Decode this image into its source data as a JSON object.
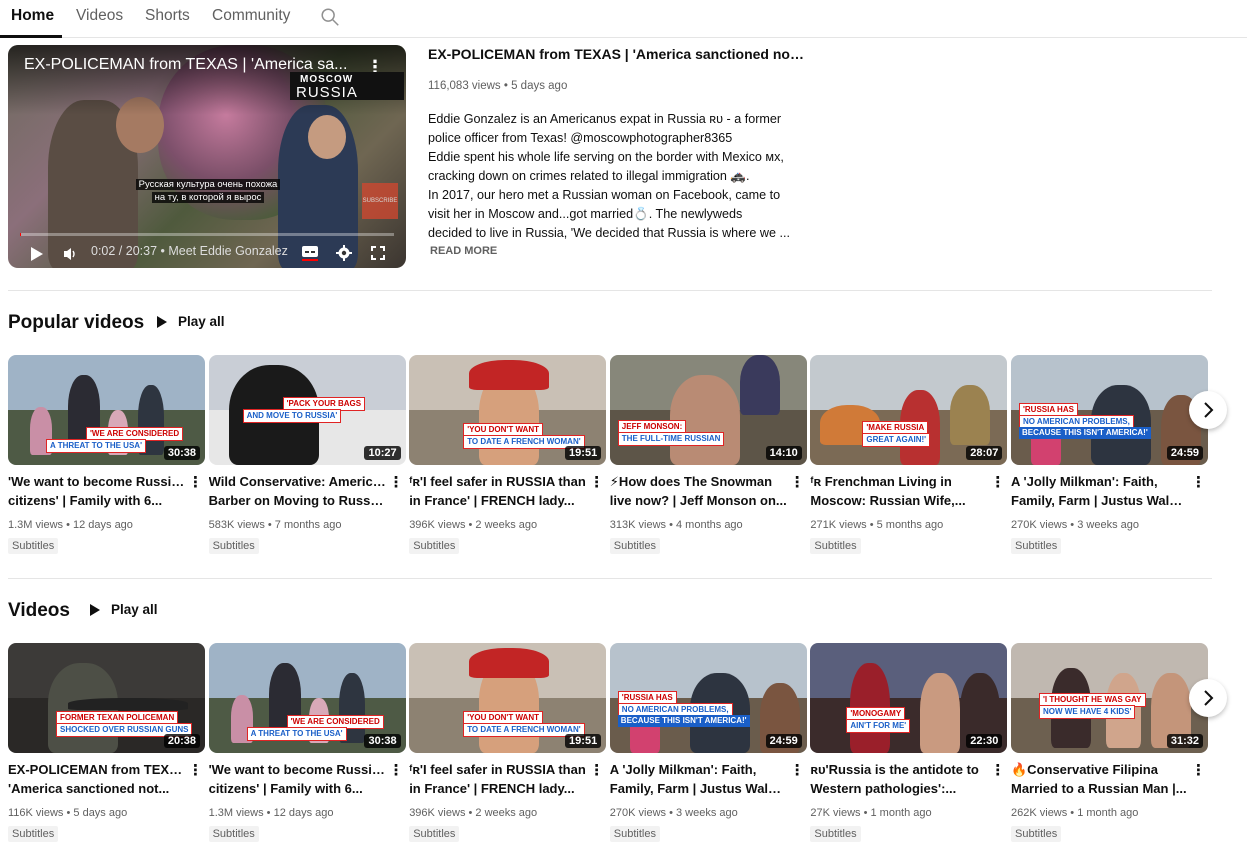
{
  "tabs": [
    {
      "label": "Home",
      "active": true
    },
    {
      "label": "Videos"
    },
    {
      "label": "Shorts"
    },
    {
      "label": "Community"
    }
  ],
  "featured": {
    "player_title": "EX-POLICEMAN from TEXAS | 'America sa...",
    "logo_top": "MOSCOW",
    "logo_bottom": "RUSSIA",
    "subtitle_line1": "Русская культура очень похожа",
    "subtitle_line2": "на ту, в которой я вырос",
    "subscribe_watermark": "SUBSCRIBE",
    "time": "0:02 / 20:37",
    "chapter": "• Meet Eddie Gonzalez",
    "progress_fraction": 0.002,
    "title": "EX-POLICEMAN from TEXAS | 'America sanctioned not Russia,...",
    "meta": "116,083 views • 5 days ago",
    "desc_lines": [
      "Eddie Gonzalez is an Americanᴜѕ expat in Russia ʀᴜ - a former",
      "police officer from Texas! @moscowphotographer8365",
      "Eddie spent his whole life serving on the border with Mexico ᴍх,",
      "cracking down on crimes related to illegal immigration 🚓.",
      "In 2017, our hero met a Russian woman on Facebook, came to",
      "visit her in Moscow and...got married💍. The newlyweds",
      "decided to live in Russia, 'We decided that Russia is where we ..."
    ],
    "read_more": "READ MORE"
  },
  "popular": {
    "title": "Popular videos",
    "play_all": "Play all",
    "videos": [
      {
        "l1": "'We want to become Russian",
        "l2": "citizens' | Family with 6...",
        "meta": "1.3M views • 12 days ago",
        "badge": "Subtitles",
        "duration": "30:38",
        "caps": [
          "'WE ARE CONSIDERED",
          "A THREAT TO THE USA'"
        ]
      },
      {
        "l1": "Wild Conservative: American",
        "l2": "Barber on Moving to Russia,...",
        "meta": "583K views • 7 months ago",
        "badge": "Subtitles",
        "duration": "10:27",
        "caps": [
          "'PACK YOUR BAGS",
          "AND MOVE TO RUSSIA'"
        ]
      },
      {
        "l1": "ᶠʀ'I feel safer in RUSSIA than",
        "l2": "in France' | FRENCH lady...",
        "meta": "396K views • 2 weeks ago",
        "badge": "Subtitles",
        "duration": "19:51",
        "caps": [
          "'YOU DON'T WANT",
          "TO DATE A FRENCH WOMAN'"
        ]
      },
      {
        "l1": "⚡How does The Snowman",
        "l2": "live now? | Jeff Monson on...",
        "meta": "313K views • 4 months ago",
        "badge": "Subtitles",
        "duration": "14:10",
        "caps": [
          "JEFF MONSON:",
          "THE FULL-TIME RUSSIAN"
        ]
      },
      {
        "l1": "ᶠʀ Frenchman Living in",
        "l2": "Moscow: Russian Wife,...",
        "meta": "271K views • 5 months ago",
        "badge": "Subtitles",
        "duration": "28:07",
        "caps": [
          "'MAKE RUSSIA",
          "GREAT AGAIN!'"
        ]
      },
      {
        "l1": "A 'Jolly Milkman': Faith,",
        "l2": "Family, Farm | Justus Walke...",
        "meta": "270K views • 3 weeks ago",
        "badge": "Subtitles",
        "duration": "24:59",
        "caps": [
          "'RUSSIA HAS",
          "NO AMERICAN PROBLEMS,",
          "BECAUSE THIS ISN'T AMERICA!'"
        ]
      }
    ]
  },
  "videos": {
    "title": "Videos",
    "play_all": "Play all",
    "videos": [
      {
        "l1": "EX-POLICEMAN from TEXAS |",
        "l2": "'America sanctioned not...",
        "meta": "116K views • 5 days ago",
        "badge": "Subtitles",
        "duration": "20:38",
        "caps": [
          "FORMER TEXAN POLICEMAN",
          "SHOCKED OVER RUSSIAN GUNS"
        ]
      },
      {
        "l1": "'We want to become Russian",
        "l2": "citizens' | Family with 6...",
        "meta": "1.3M views • 12 days ago",
        "badge": "Subtitles",
        "duration": "30:38",
        "caps": [
          "'WE ARE CONSIDERED",
          "A THREAT TO THE USA'"
        ]
      },
      {
        "l1": "ᶠʀ'I feel safer in RUSSIA than",
        "l2": "in France' | FRENCH lady...",
        "meta": "396K views • 2 weeks ago",
        "badge": "Subtitles",
        "duration": "19:51",
        "caps": [
          "'YOU DON'T WANT",
          "TO DATE A FRENCH WOMAN'"
        ]
      },
      {
        "l1": "A 'Jolly Milkman': Faith,",
        "l2": "Family, Farm | Justus Walke...",
        "meta": "270K views • 3 weeks ago",
        "badge": "Subtitles",
        "duration": "24:59",
        "caps": [
          "'RUSSIA HAS",
          "NO AMERICAN PROBLEMS,",
          "BECAUSE THIS ISN'T AMERICA!'"
        ]
      },
      {
        "l1": "ʀᴜ'Russia is the antidote to",
        "l2": "Western pathologies':...",
        "meta": "27K views • 1 month ago",
        "badge": "Subtitles",
        "duration": "22:30",
        "caps": [
          "'MONOGAMY",
          "AIN'T FOR ME'"
        ]
      },
      {
        "l1": "🔥Conservative Filipina",
        "l2": "Married to a Russian Man |...",
        "meta": "262K views • 1 month ago",
        "badge": "Subtitles",
        "duration": "31:32",
        "caps": [
          "'I THOUGHT HE WAS GAY",
          "NOW WE HAVE 4 KIDS'"
        ]
      }
    ]
  }
}
